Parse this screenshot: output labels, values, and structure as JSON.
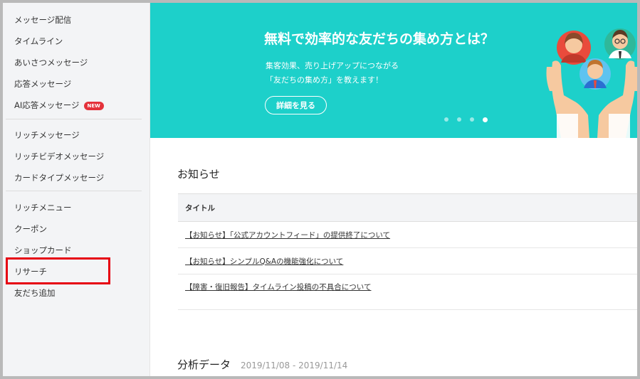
{
  "sidebar": {
    "groups": [
      [
        {
          "label": "メッセージ配信",
          "name": "message-delivery"
        },
        {
          "label": "タイムライン",
          "name": "timeline"
        },
        {
          "label": "あいさつメッセージ",
          "name": "greeting-message"
        },
        {
          "label": "応答メッセージ",
          "name": "response-message"
        },
        {
          "label": "AI応答メッセージ",
          "name": "ai-response-message",
          "badge": "NEW"
        }
      ],
      [
        {
          "label": "リッチメッセージ",
          "name": "rich-message"
        },
        {
          "label": "リッチビデオメッセージ",
          "name": "rich-video-message"
        },
        {
          "label": "カードタイプメッセージ",
          "name": "card-type-message"
        }
      ],
      [
        {
          "label": "リッチメニュー",
          "name": "rich-menu"
        },
        {
          "label": "クーポン",
          "name": "coupon"
        },
        {
          "label": "ショップカード",
          "name": "shop-card"
        },
        {
          "label": "リサーチ",
          "name": "research",
          "highlighted": true
        },
        {
          "label": "友だち追加",
          "name": "add-friends"
        }
      ]
    ]
  },
  "banner": {
    "title": "無料で効率的な友だちの集め方とは？",
    "subtitle_lines": [
      "集客効果、売り上げアップにつながる",
      "「友だちの集め方」を教えます！"
    ],
    "button_label": "詳細を見る",
    "carousel": {
      "count": 4,
      "active_index": 3
    },
    "color": "#1dd0ca"
  },
  "notices": {
    "title": "お知らせ",
    "column_header": "タイトル",
    "items": [
      "【お知らせ】「公式アカウントフィード」の提供終了について",
      "【お知らせ】シンプルQ&Aの機能強化について",
      "【障害・復旧報告】タイムライン投稿の不具合について"
    ]
  },
  "analysis": {
    "title": "分析データ",
    "date_range": "2019/11/08 - 2019/11/14"
  },
  "colors": {
    "highlight": "#e60012",
    "badge": "#e4323b",
    "sidebar_bg": "#f3f4f6"
  }
}
